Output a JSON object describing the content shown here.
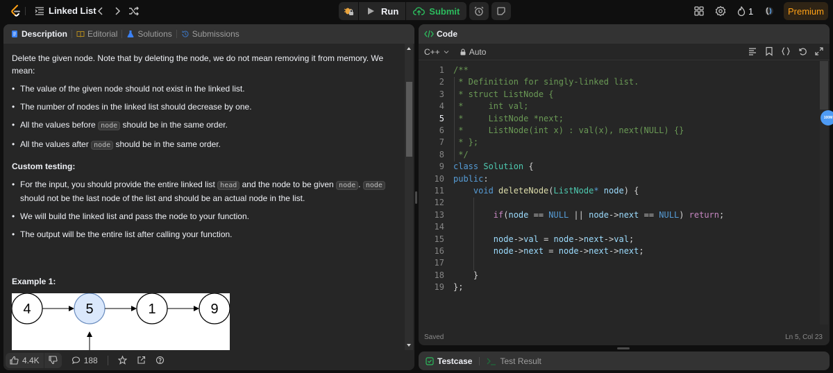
{
  "topbar": {
    "problem_list_title": "Linked List",
    "run_label": "Run",
    "submit_label": "Submit",
    "streak_count": "1",
    "premium_label": "Premium"
  },
  "left_panel": {
    "tabs": [
      {
        "label": "Description",
        "active": true
      },
      {
        "label": "Editorial",
        "active": false
      },
      {
        "label": "Solutions",
        "active": false
      },
      {
        "label": "Submissions",
        "active": false
      }
    ],
    "intro": "Delete the given node. Note that by deleting the node, we do not mean removing it from memory. We mean:",
    "bullets1": [
      {
        "pre": "The value of the given node should not exist in the linked list.",
        "code": "",
        "post": ""
      },
      {
        "pre": "The number of nodes in the linked list should decrease by one.",
        "code": "",
        "post": ""
      },
      {
        "pre": "All the values before ",
        "code": "node",
        "post": " should be in the same order."
      },
      {
        "pre": "All the values after ",
        "code": "node",
        "post": " should be in the same order."
      }
    ],
    "custom_testing_heading": "Custom testing:",
    "bullets2": {
      "b1_pre": "For the input, you should provide the entire linked list ",
      "b1_code1": "head",
      "b1_mid": " and the node to be given ",
      "b1_code2": "node",
      "b1_dot": ". ",
      "b1_code3": "node",
      "b1_post": " should not be the last node of the list and should be an actual node in the list.",
      "b2": "We will build the linked list and pass the node to your function.",
      "b3": "The output will be the entire list after calling your function."
    },
    "example_heading": "Example 1:",
    "example_nodes": [
      "4",
      "5",
      "1",
      "9"
    ],
    "example_highlight_index": 1,
    "footer": {
      "likes": "4.4K",
      "comments": "188"
    }
  },
  "code_panel": {
    "title": "Code",
    "language": "C++",
    "mode": "Auto",
    "current_line": 5,
    "lines": [
      [
        [
          "c-com",
          "/**"
        ]
      ],
      [
        [
          "c-com",
          " * Definition for singly-linked list."
        ]
      ],
      [
        [
          "c-com",
          " * struct ListNode {"
        ]
      ],
      [
        [
          "c-com",
          " *     int val;"
        ]
      ],
      [
        [
          "c-com",
          " *     ListNode *next;"
        ]
      ],
      [
        [
          "c-com",
          " *     ListNode(int x) : val(x), next(NULL) {}"
        ]
      ],
      [
        [
          "c-com",
          " * };"
        ]
      ],
      [
        [
          "c-com",
          " */"
        ]
      ],
      [
        [
          "c-kw",
          "class "
        ],
        [
          "c-type",
          "Solution"
        ],
        [
          "c-punc",
          " {"
        ]
      ],
      [
        [
          "c-kw",
          "public"
        ],
        [
          "c-punc",
          ":"
        ]
      ],
      [
        [
          "c-punc",
          "    "
        ],
        [
          "c-kw",
          "void "
        ],
        [
          "c-fn",
          "deleteNode"
        ],
        [
          "c-punc",
          "("
        ],
        [
          "c-type",
          "ListNode"
        ],
        [
          "c-kw",
          "*"
        ],
        [
          "c-punc",
          " "
        ],
        [
          "c-var",
          "node"
        ],
        [
          "c-punc",
          ") {"
        ]
      ],
      [
        [
          "c-punc",
          ""
        ]
      ],
      [
        [
          "c-punc",
          "        "
        ],
        [
          "c-ctl",
          "if"
        ],
        [
          "c-punc",
          "("
        ],
        [
          "c-var",
          "node"
        ],
        [
          "c-punc",
          " == "
        ],
        [
          "c-const",
          "NULL"
        ],
        [
          "c-punc",
          " || "
        ],
        [
          "c-var",
          "node"
        ],
        [
          "c-punc",
          "->"
        ],
        [
          "c-var",
          "next"
        ],
        [
          "c-punc",
          " == "
        ],
        [
          "c-const",
          "NULL"
        ],
        [
          "c-punc",
          ") "
        ],
        [
          "c-ctl",
          "return"
        ],
        [
          "c-punc",
          ";"
        ]
      ],
      [
        [
          "c-punc",
          ""
        ]
      ],
      [
        [
          "c-punc",
          "        "
        ],
        [
          "c-var",
          "node"
        ],
        [
          "c-punc",
          "->"
        ],
        [
          "c-var",
          "val"
        ],
        [
          "c-punc",
          " = "
        ],
        [
          "c-var",
          "node"
        ],
        [
          "c-punc",
          "->"
        ],
        [
          "c-var",
          "next"
        ],
        [
          "c-punc",
          "->"
        ],
        [
          "c-var",
          "val"
        ],
        [
          "c-punc",
          ";"
        ]
      ],
      [
        [
          "c-punc",
          "        "
        ],
        [
          "c-var",
          "node"
        ],
        [
          "c-punc",
          "->"
        ],
        [
          "c-var",
          "next"
        ],
        [
          "c-punc",
          " = "
        ],
        [
          "c-var",
          "node"
        ],
        [
          "c-punc",
          "->"
        ],
        [
          "c-var",
          "next"
        ],
        [
          "c-punc",
          "->"
        ],
        [
          "c-var",
          "next"
        ],
        [
          "c-punc",
          ";"
        ]
      ],
      [
        [
          "c-punc",
          ""
        ]
      ],
      [
        [
          "c-punc",
          "    }"
        ]
      ],
      [
        [
          "c-punc",
          "};"
        ]
      ]
    ],
    "status_saved": "Saved",
    "cursor_position": "Ln 5, Col 23",
    "memory_badge": "100M"
  },
  "test_panel": {
    "tabs": [
      {
        "label": "Testcase",
        "active": true
      },
      {
        "label": "Test Result",
        "active": false
      }
    ]
  },
  "colors": {
    "accent_orange": "#ffa116",
    "submit_green": "#2cbb5d",
    "highlight_node": "#dae8fc"
  }
}
